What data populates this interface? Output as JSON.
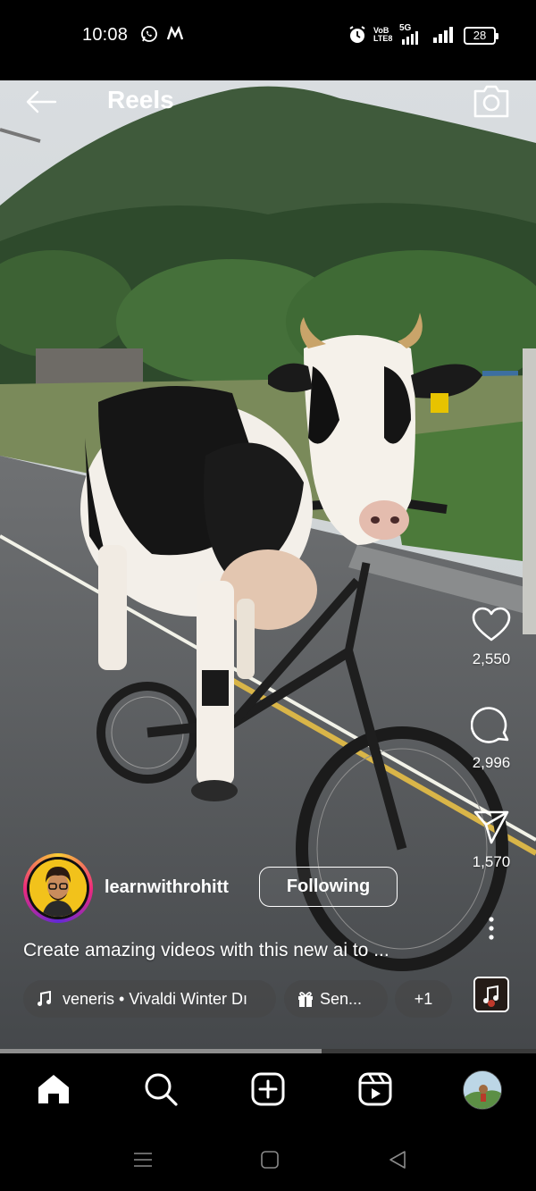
{
  "status_bar": {
    "time": "10:08",
    "network_label": "VoB LTE8",
    "network_type": "5G",
    "battery": "28"
  },
  "header": {
    "title": "Reels"
  },
  "actions": {
    "likes": "2,550",
    "comments": "2,996",
    "shares": "1,570"
  },
  "author": {
    "username": "learnwithrohitt",
    "follow_label": "Following"
  },
  "caption": "Create amazing videos with this new ai to ...",
  "chips": {
    "music": "veneris • Vivaldi Winter Dı",
    "gift": "Sen...",
    "more": "+1"
  },
  "progress": 0.6,
  "icons": {
    "back": "arrow-left-icon",
    "camera": "camera-icon",
    "like": "heart-icon",
    "comment": "comment-icon",
    "share": "send-icon",
    "more": "more-vertical-icon",
    "home": "home-icon",
    "search": "search-icon",
    "create": "plus-square-icon",
    "reels": "reels-icon"
  },
  "colors": {
    "background": "#000000",
    "text": "#ffffff",
    "avatar_bg": "#f2c21b"
  }
}
